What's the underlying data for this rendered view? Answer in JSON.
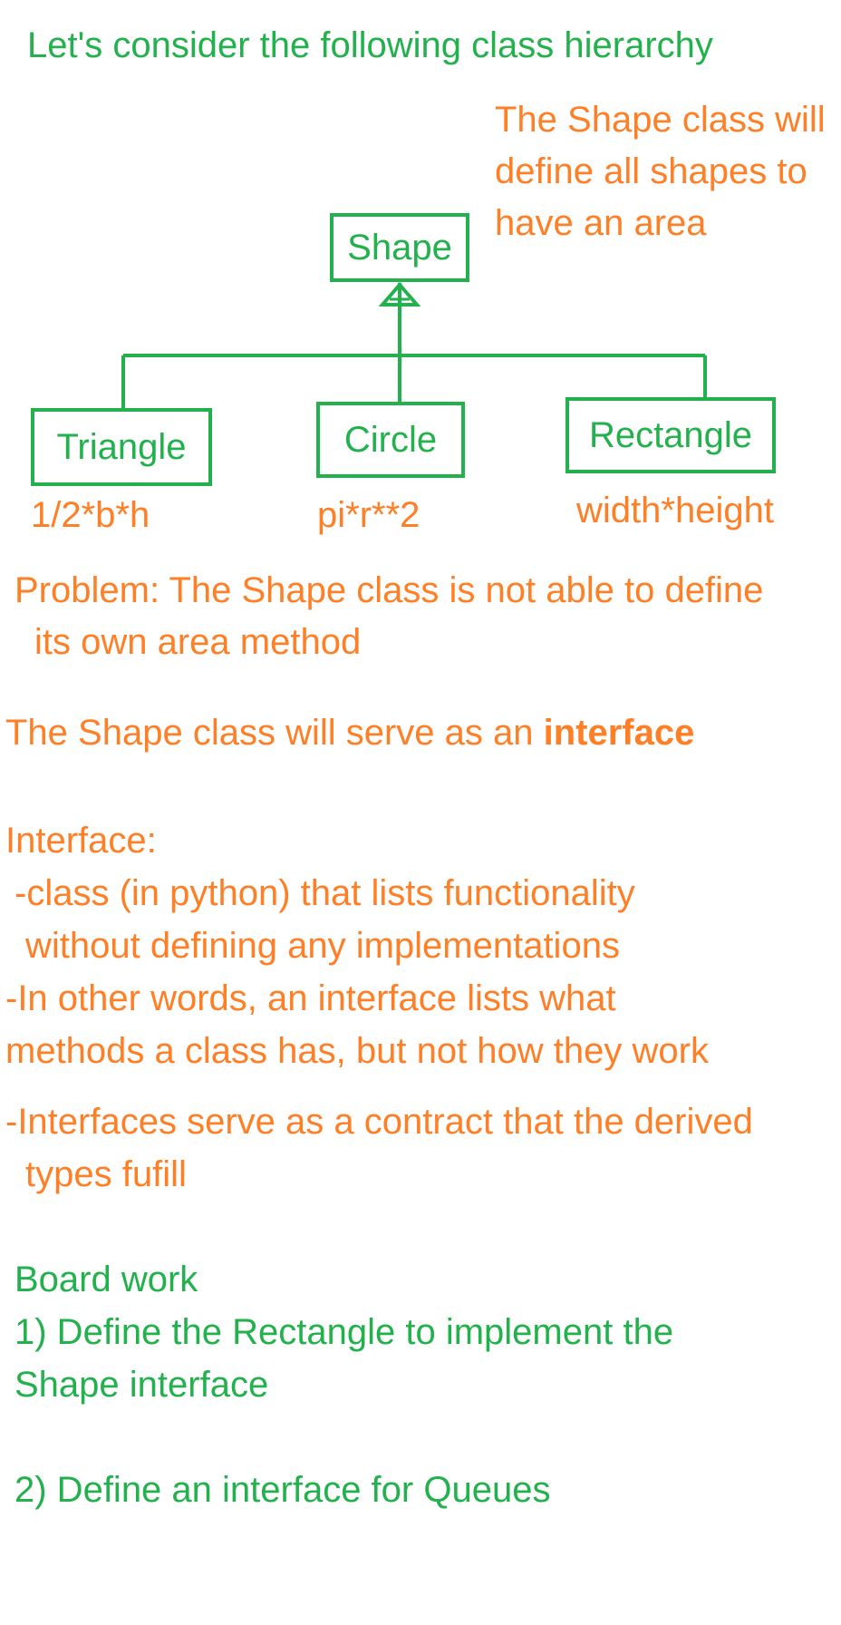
{
  "heading": "Let's consider the following class hierarchy",
  "shape_note": [
    "The Shape class will",
    "define all shapes to",
    "have an area"
  ],
  "diagram": {
    "parent": "Shape",
    "children": [
      {
        "name": "Triangle",
        "formula": "1/2*b*h"
      },
      {
        "name": "Circle",
        "formula": "pi*r**2"
      },
      {
        "name": "Rectangle",
        "formula": "width*height"
      }
    ]
  },
  "problem": [
    "Problem: The Shape class is not able to define",
    "its own area method"
  ],
  "interface_statement": {
    "prefix": "The Shape class will serve as an ",
    "bold": "interface"
  },
  "interface_def": {
    "title": "Interface:",
    "lines": [
      "-class (in python) that lists functionality",
      "without defining any implementations",
      "-In other words, an interface lists what",
      "methods a class has, but not how they work",
      "-Interfaces serve as a contract that the derived",
      "types fufill"
    ]
  },
  "board_work": {
    "title": "Board work",
    "items": [
      "1) Define the Rectangle to implement the",
      "Shape interface",
      "2) Define an interface for Queues"
    ]
  },
  "colors": {
    "green": "#22b14c",
    "orange": "#ff7f27"
  }
}
